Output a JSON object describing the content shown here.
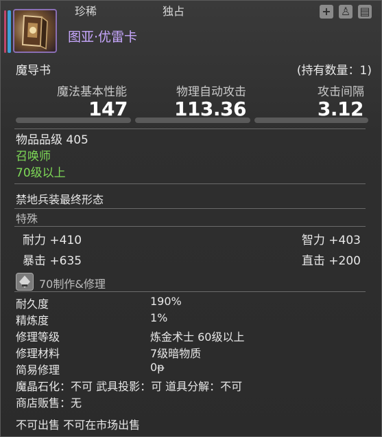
{
  "tags": [
    "珍稀",
    "独占"
  ],
  "item": {
    "name": "图亚·优雷卡",
    "category": "魔导书",
    "owned": "(持有数量：1)"
  },
  "stats": {
    "headers": [
      "魔法基本性能",
      "物理自动攻击",
      "攻击间隔"
    ],
    "values": [
      "147",
      "113.36",
      "3.12"
    ]
  },
  "item_level": "物品品级 405",
  "job": "召唤师",
  "level_req": "70级以上",
  "set_name": "禁地兵装最终形态",
  "special_label": "特殊",
  "attributes": {
    "left": [
      {
        "text": "耐力 +410"
      },
      {
        "text": "暴击 +635"
      }
    ],
    "right": [
      {
        "text": "智力 +403"
      },
      {
        "text": "直击 +200"
      }
    ]
  },
  "crafting": {
    "label": "70制作&修理"
  },
  "details": [
    {
      "label": "耐久度",
      "value": "190%"
    },
    {
      "label": "精炼度",
      "value": "1%"
    },
    {
      "label": "修理等级",
      "value": "炼金术士 60级以上"
    },
    {
      "label": "修理材料",
      "value": "7级暗物质"
    },
    {
      "label": "简易修理",
      "value": "0ᵽ"
    }
  ],
  "flags_line1": "魔晶石化：不可   武具投影：可   道具分解：不可",
  "flags_line2": "商店贩售：无",
  "footer": "不可出售   不可在市场出售",
  "colors": {
    "name": "#c8a8ff",
    "green": "#7ed957",
    "accent": "#3fa0d8"
  }
}
